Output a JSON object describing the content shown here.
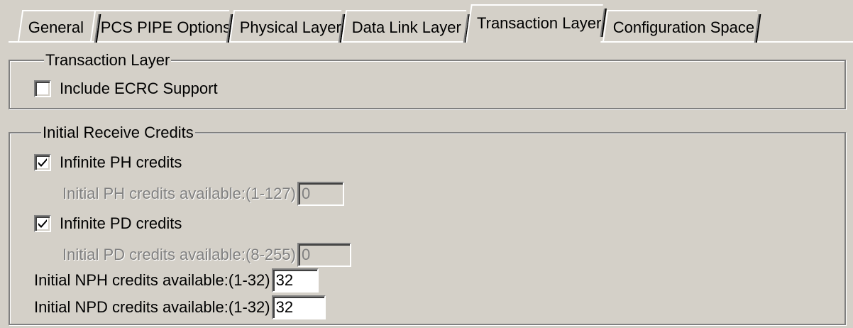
{
  "tabs": [
    {
      "label": "General"
    },
    {
      "label": "PCS PIPE Options"
    },
    {
      "label": "Physical Layer"
    },
    {
      "label": "Data Link Layer"
    },
    {
      "label": "Transaction Layer"
    },
    {
      "label": "Configuration Space"
    }
  ],
  "active_tab": "Transaction Layer",
  "transaction_group": {
    "title": "Transaction Layer",
    "ecrc": {
      "label": "Include ECRC Support",
      "checked": false
    }
  },
  "credits_group": {
    "title": "Initial Receive Credits",
    "infinite_ph": {
      "label": "Infinite PH credits",
      "checked": true
    },
    "ph_available": {
      "label": "Initial PH credits available:(1-127)",
      "value": "0",
      "enabled": false
    },
    "infinite_pd": {
      "label": "Infinite PD credits",
      "checked": true
    },
    "pd_available": {
      "label": "Initial PD credits available:(8-255)",
      "value": "0",
      "enabled": false
    },
    "nph_available": {
      "label": "Initial NPH credits available:(1-32)",
      "value": "32",
      "enabled": true
    },
    "npd_available": {
      "label": "Initial NPD credits available:(1-32)",
      "value": "32",
      "enabled": true
    }
  },
  "colors": {
    "face": "#d4d0c8",
    "shadow": "#808080",
    "highlight": "#ffffff"
  }
}
